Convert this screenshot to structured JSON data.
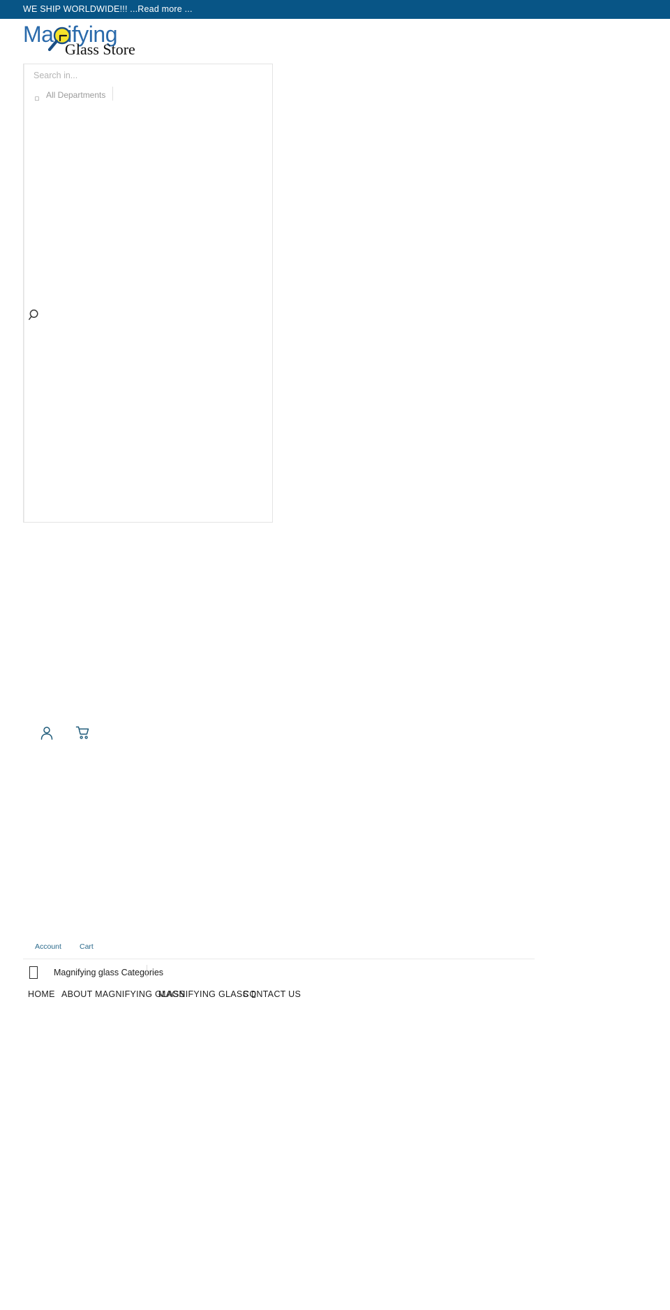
{
  "announcement": {
    "text": "WE SHIP WORLDWIDE!!! ...Read more ...",
    "background": "#085586",
    "color": "#ffffff"
  },
  "logo": {
    "line1": "Magnifying",
    "line2": "Glass Store",
    "line1_color": "#2a6aab",
    "line2_color": "#111111",
    "lens_color": "#f5e32a",
    "alt": "Magnifying Glass Store"
  },
  "search": {
    "placeholder": "Search in...",
    "value": "",
    "department_label": "All Departments",
    "department_glyph": "▫",
    "submit_icon": "search-icon"
  },
  "account_bar": {
    "person_icon": "user-icon",
    "cart_icon": "shopping-cart-icon",
    "account_label": "Account",
    "cart_label": "Cart",
    "link_color": "#2b6a8c"
  },
  "categories": {
    "label": "Magnifying glass Categories",
    "icon": "menu-bars-icon"
  },
  "main_nav": {
    "items": [
      {
        "label": "HOME",
        "has_caret": false
      },
      {
        "label": "ABOUT MAGNIFYING GLASS",
        "has_caret": false
      },
      {
        "label": "MAGNIFYING GLASS",
        "has_caret": true
      },
      {
        "label": "CONTACT US",
        "has_caret": false
      }
    ]
  }
}
